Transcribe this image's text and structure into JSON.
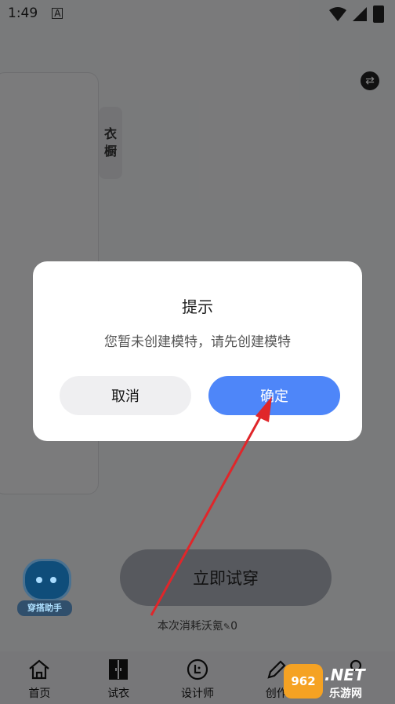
{
  "status": {
    "time": "1:49",
    "notif": "A"
  },
  "wardrobe_tab": {
    "line1": "衣",
    "line2": "橱"
  },
  "assistant_label": "穿搭助手",
  "try_on_button": "立即试穿",
  "consumption": {
    "text": "本次消耗沃氪",
    "value": "0"
  },
  "bottom_nav": [
    {
      "label": "首页",
      "icon": "home-icon"
    },
    {
      "label": "试衣",
      "icon": "wardrobe-icon"
    },
    {
      "label": "设计师",
      "icon": "designer-icon"
    },
    {
      "label": "创作",
      "icon": "pen-icon"
    }
  ],
  "dialog": {
    "title": "提示",
    "message": "您暂未创建模特，请先创建模特",
    "cancel": "取消",
    "confirm": "确定"
  },
  "watermark": {
    "logo": "962",
    "domain": ".NET",
    "name": "乐游网"
  },
  "colors": {
    "accent": "#4e86f9",
    "annotation_arrow": "#e0262a"
  }
}
